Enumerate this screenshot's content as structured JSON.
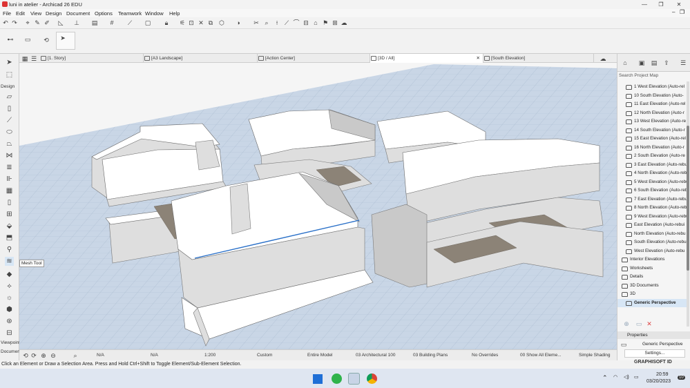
{
  "window": {
    "title": "luni in atelier - Archicad 26 EDU",
    "minimize": "—",
    "maximize": "❐",
    "close": "✕"
  },
  "menu": [
    "File",
    "Edit",
    "View",
    "Design",
    "Document",
    "Options",
    "Teamwork",
    "Window",
    "Help"
  ],
  "toolbox": {
    "section_design": "Design",
    "section_viewpoint": "Viewpoint",
    "section_document": "Documen",
    "tooltip": "Mesh Tool"
  },
  "tabs": [
    {
      "label": "[1. Story]",
      "icon": "floor-plan-icon"
    },
    {
      "label": "[A3 Landscape]",
      "icon": "layout-icon"
    },
    {
      "label": "[Action Center]",
      "icon": "action-center-icon"
    },
    {
      "label": "[3D / All]",
      "icon": "3d-view-icon",
      "active": true,
      "close": "✕"
    },
    {
      "label": "[South Elevation]",
      "icon": "elevation-icon"
    }
  ],
  "statusbar": {
    "na1": "N/A",
    "na2": "N/A",
    "scale": "1:200",
    "pen_set": "Custom",
    "model": "Entire Model",
    "layer": "03 Architectural 100",
    "structure": "03 Building Plans",
    "overrides": "No Overrides",
    "renovation": "00 Show All Eleme...",
    "shading": "Simple Shading"
  },
  "hint": "Click an Element or Draw a Selection Area. Press and Hold Ctrl+Shift to Toggle Element/Sub-Element Selection.",
  "navigator": {
    "search_placeholder": "Search Project Map",
    "items": [
      {
        "label": "1 West Elevation (Auto-rel",
        "level": 2
      },
      {
        "label": "10 South Elevation (Auto-",
        "level": 2
      },
      {
        "label": "11 East Elevation (Auto-rel",
        "level": 2
      },
      {
        "label": "12 North Elevation (Auto-r",
        "level": 2
      },
      {
        "label": "13 West Elevation (Auto-re",
        "level": 2
      },
      {
        "label": "14 South Elevation (Auto-r",
        "level": 2
      },
      {
        "label": "15 East Elevation (Auto-rel",
        "level": 2
      },
      {
        "label": "16 North Elevation (Auto-r",
        "level": 2
      },
      {
        "label": "2 South Elevation (Auto-re",
        "level": 2
      },
      {
        "label": "3 East Elevation (Auto-rebu",
        "level": 2
      },
      {
        "label": "4 North Elevation (Auto-reb",
        "level": 2
      },
      {
        "label": "5 West Elevation (Auto-rebu",
        "level": 2
      },
      {
        "label": "6 South Elevation (Auto-reb",
        "level": 2
      },
      {
        "label": "7 East Elevation (Auto-rebu",
        "level": 2
      },
      {
        "label": "8 North Elevation (Auto-reb",
        "level": 2
      },
      {
        "label": "9 West Elevation (Auto-rebu",
        "level": 2
      },
      {
        "label": "East Elevation (Auto-rebui",
        "level": 2
      },
      {
        "label": "North Elevation (Auto-rebu",
        "level": 2
      },
      {
        "label": "South Elevation (Auto-rebu",
        "level": 2
      },
      {
        "label": "West Elevation (Auto-rebu",
        "level": 2
      },
      {
        "label": "Interior Elevations",
        "level": 1
      },
      {
        "label": "Worksheets",
        "level": 1
      },
      {
        "label": "Details",
        "level": 1
      },
      {
        "label": "3D Documents",
        "level": 1
      },
      {
        "label": "3D",
        "level": 1,
        "expanded": true
      },
      {
        "label": "Generic Perspective",
        "level": 2,
        "selected": true
      }
    ],
    "properties_header": "Properties",
    "properties_value": "Generic Perspective",
    "settings_button": "Settings...",
    "brand": "GRAPHISOFT ID"
  },
  "taskbar": {
    "time": "20:59",
    "date": "03/20/2023",
    "notification_count": "10",
    "apps": [
      "windows-start-icon",
      "whatsapp-icon",
      "archicad-icon",
      "chrome-icon"
    ]
  }
}
